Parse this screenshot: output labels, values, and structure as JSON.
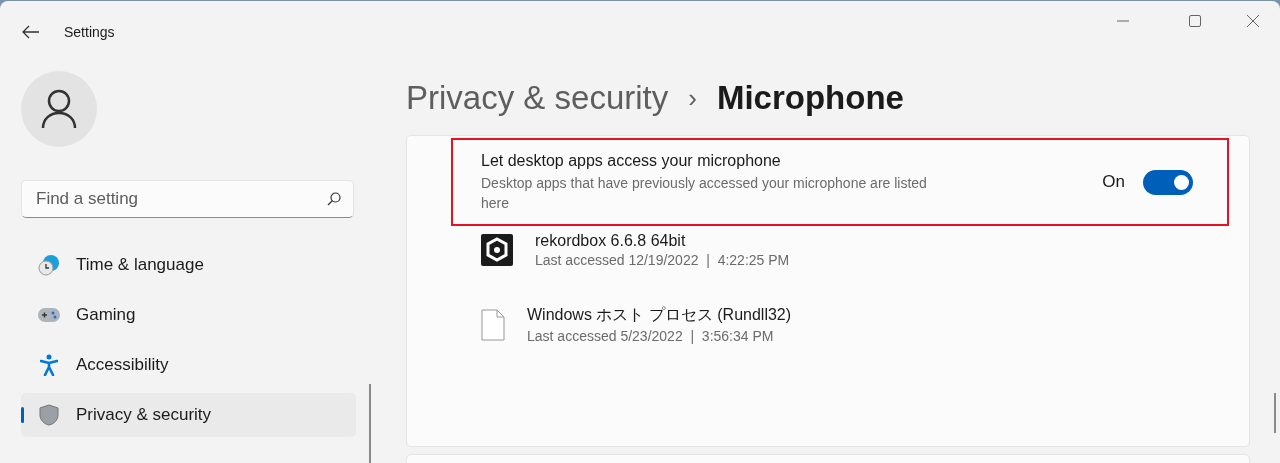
{
  "window": {
    "title": "Settings"
  },
  "sidebar": {
    "search": {
      "placeholder": "Find a setting"
    },
    "items": [
      {
        "kind": "time",
        "label": "Time & language",
        "selected": false
      },
      {
        "kind": "gaming",
        "label": "Gaming",
        "selected": false
      },
      {
        "kind": "accessibility",
        "label": "Accessibility",
        "selected": false
      },
      {
        "kind": "privacy",
        "label": "Privacy & security",
        "selected": true
      }
    ]
  },
  "breadcrumb": {
    "parent": "Privacy & security",
    "separator": "›",
    "current": "Microphone"
  },
  "setting": {
    "title": "Let desktop apps access your microphone",
    "description": "Desktop apps that have previously accessed your microphone are listed here",
    "state_label": "On",
    "on": true,
    "highlighted": true
  },
  "apps": [
    {
      "kind": "rekordbox",
      "name": "rekordbox 6.6.8 64bit",
      "last_accessed": "Last accessed 12/19/2022  |  4:22:25 PM"
    },
    {
      "kind": "file",
      "name": "Windows ホスト プロセス (Rundll32)",
      "last_accessed": "Last accessed 5/23/2022  |  3:56:34 PM"
    }
  ]
}
